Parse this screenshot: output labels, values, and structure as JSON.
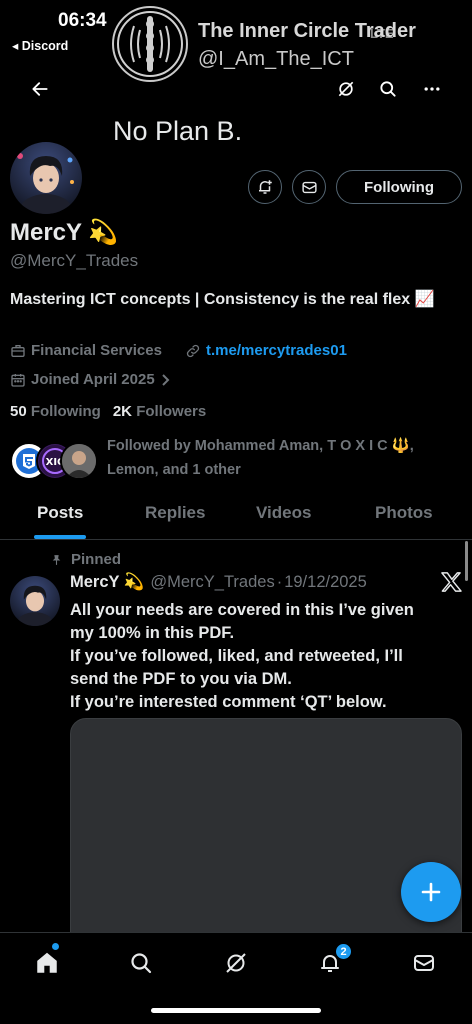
{
  "status_bar": {
    "time": "06:34",
    "back_app": "◂ Discord",
    "network": "LTE"
  },
  "overlay": {
    "name": "The Inner Circle Trader",
    "handle": "@I_Am_The_ICT"
  },
  "header": {
    "back_icon": "arrow-left-icon",
    "grok_icon": "grok-icon",
    "search_icon": "search-icon",
    "more_icon": "more-icon"
  },
  "profile": {
    "banner_text": "No Plan B.",
    "display_name": "MercY 💫",
    "handle": "@MercY_Trades",
    "bio": "Mastering ICT concepts | Consistency is the real flex 📈",
    "category": "Financial Services",
    "website": "t.me/mercytrades01",
    "joined": "Joined April 2025",
    "following_count": "50",
    "following_label": "Following",
    "followers_count": "2K",
    "followers_label": "Followers",
    "followed_by": "Followed by Mohammed Aman, T O X I C 🔱, Lemon, and 1 other",
    "follow_button": "Following"
  },
  "tabs": [
    "Posts",
    "Replies",
    "Videos",
    "Photos"
  ],
  "post": {
    "pinned_label": "Pinned",
    "author": "MercY 💫",
    "handle": "@MercY_Trades",
    "separator": "·",
    "date": "19/12/2025",
    "lines": [
      "All your needs are covered in this I’ve given",
      "my 100% in this PDF.",
      "If you’ve followed, liked, and retweeted, I’ll",
      "send the PDF to you via DM.",
      "If you’re interested comment ‘QT’ below."
    ]
  },
  "fab": {
    "label": "+"
  },
  "nav": {
    "notifications_badge": "2"
  },
  "colors": {
    "accent": "#1d9bf0",
    "background": "#000000",
    "muted": "#71767b",
    "text": "#e7e9ea"
  }
}
